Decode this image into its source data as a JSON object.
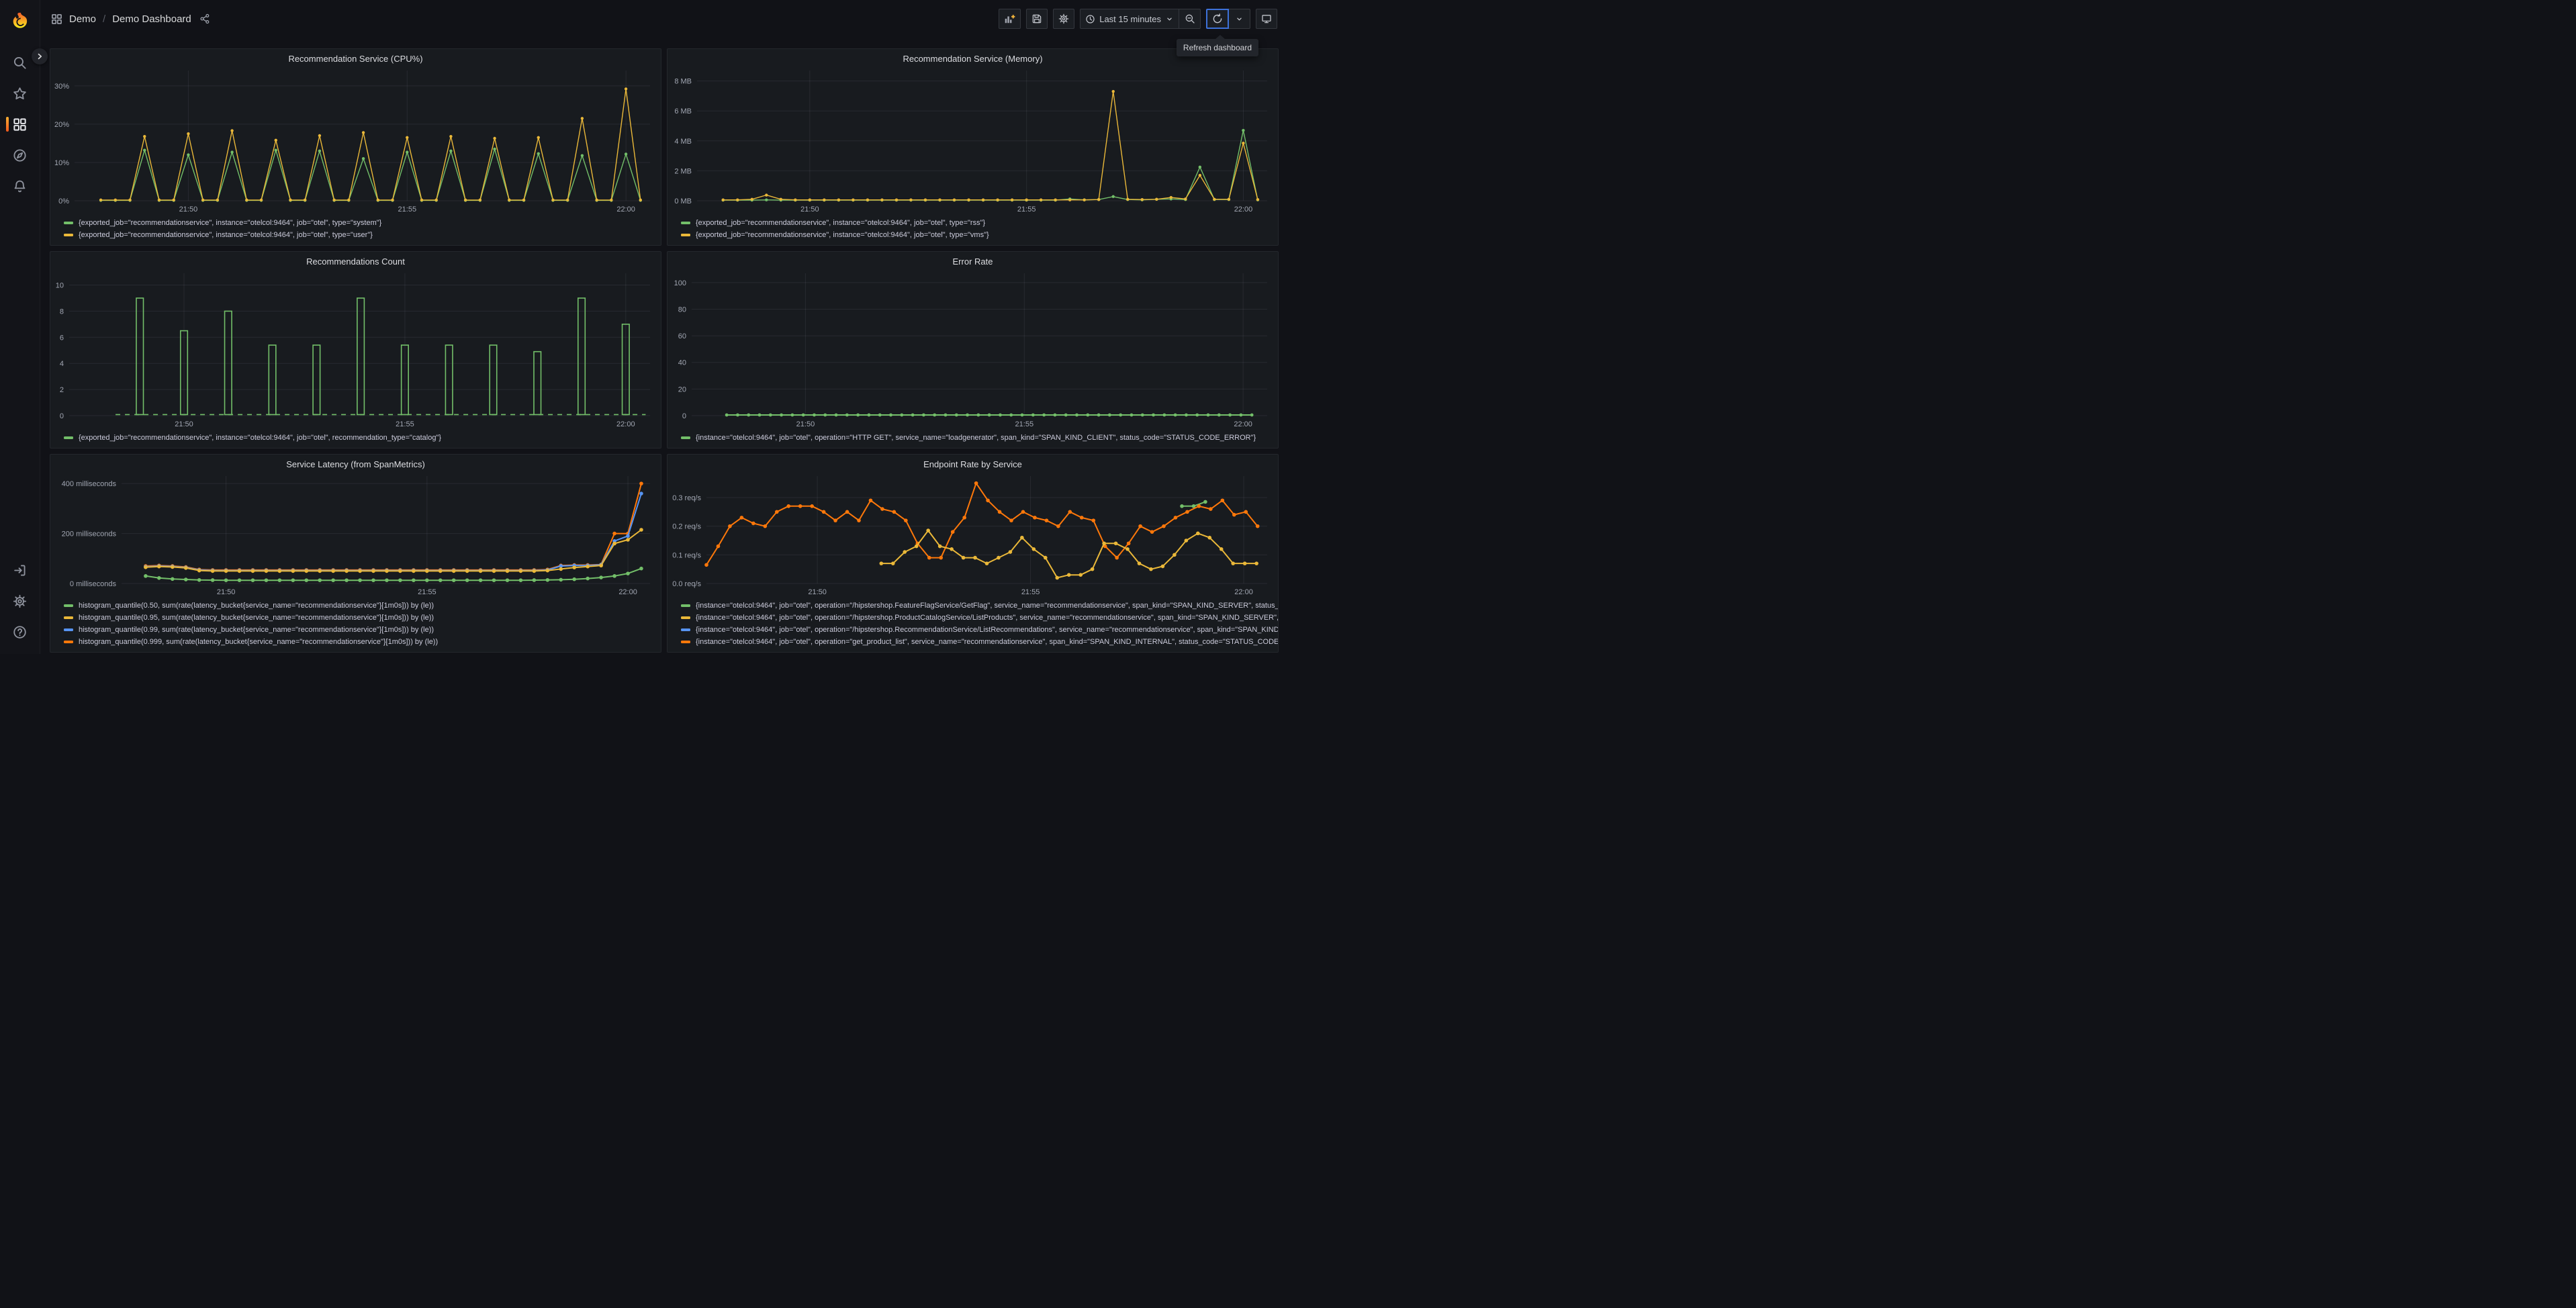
{
  "app": {
    "accent_orange": "#F46800",
    "focus_blue": "#3D71D9",
    "panel_bg": "#181B1F",
    "canvas_bg": "#111217"
  },
  "header": {
    "breadcrumb": {
      "section": "Demo",
      "separator": "/",
      "page": "Demo Dashboard"
    },
    "toolbar": {
      "time_range": "Last 15 minutes",
      "tooltip": "Refresh dashboard"
    }
  },
  "panels": [
    {
      "title": "Recommendation Service (CPU%)",
      "legend": [
        {
          "color": "#73BF69",
          "label": "{exported_job=\"recommendationservice\", instance=\"otelcol:9464\", job=\"otel\", type=\"system\"}"
        },
        {
          "color": "#EAB839",
          "label": "{exported_job=\"recommendationservice\", instance=\"otelcol:9464\", job=\"otel\", type=\"user\"}"
        }
      ],
      "chart_data": {
        "type": "line",
        "ml": 36,
        "xlim": [
          1.4,
          14.55
        ],
        "ylim": [
          0,
          34
        ],
        "xticks": [
          {
            "v": 4,
            "label": "21:50"
          },
          {
            "v": 9,
            "label": "21:55"
          },
          {
            "v": 14,
            "label": "22:00"
          }
        ],
        "yticks": [
          {
            "v": 0,
            "label": "0%"
          },
          {
            "v": 10,
            "label": "10%"
          },
          {
            "v": 20,
            "label": "20%"
          },
          {
            "v": 30,
            "label": "30%"
          }
        ],
        "series": [
          {
            "name": "system",
            "color": "#73BF69",
            "x0": 2.0,
            "dx": 0.3333,
            "lw": 1.4,
            "r": 2.2,
            "y": [
              0.1,
              0.1,
              0.1,
              13.2,
              0.1,
              0.1,
              12,
              0.1,
              0.1,
              12.7,
              0.1,
              0.1,
              13.2,
              0.1,
              0.1,
              13,
              0.1,
              0.1,
              11,
              0.1,
              0.1,
              12.7,
              0.1,
              0.1,
              13,
              0.1,
              0.1,
              13.5,
              0.1,
              0.1,
              12.3,
              0.1,
              0.1,
              11.8,
              0.1,
              0.1,
              12.2,
              0.1
            ]
          },
          {
            "name": "user",
            "color": "#EAB839",
            "x0": 2.0,
            "dx": 0.3333,
            "lw": 1.4,
            "r": 2.2,
            "y": [
              0.2,
              0.2,
              0.2,
              16.8,
              0.2,
              0.2,
              17.5,
              0.2,
              0.2,
              18.3,
              0.2,
              0.2,
              15.8,
              0.2,
              0.2,
              17,
              0.2,
              0.2,
              17.8,
              0.2,
              0.2,
              16.5,
              0.2,
              0.2,
              16.8,
              0.2,
              0.2,
              16.3,
              0.2,
              0.2,
              16.5,
              0.2,
              0.2,
              21.5,
              0.2,
              0.2,
              29.2,
              0.2
            ]
          }
        ]
      }
    },
    {
      "title": "Recommendation Service (Memory)",
      "legend": [
        {
          "color": "#73BF69",
          "label": "{exported_job=\"recommendationservice\", instance=\"otelcol:9464\", job=\"otel\", type=\"rss\"}"
        },
        {
          "color": "#EAB839",
          "label": "{exported_job=\"recommendationservice\", instance=\"otelcol:9464\", job=\"otel\", type=\"vms\"}"
        }
      ],
      "chart_data": {
        "type": "line",
        "ml": 44,
        "xlim": [
          1.4,
          14.55
        ],
        "ylim": [
          0,
          8.7
        ],
        "xticks": [
          {
            "v": 4,
            "label": "21:50"
          },
          {
            "v": 9,
            "label": "21:55"
          },
          {
            "v": 14,
            "label": "22:00"
          }
        ],
        "yticks": [
          {
            "v": 0,
            "label": "0 MB"
          },
          {
            "v": 2,
            "label": "2 MB"
          },
          {
            "v": 4,
            "label": "4 MB"
          },
          {
            "v": 6,
            "label": "6 MB"
          },
          {
            "v": 8,
            "label": "8 MB"
          }
        ],
        "series": [
          {
            "name": "rss",
            "color": "#73BF69",
            "x0": 2.0,
            "dx": 0.3333,
            "lw": 1.4,
            "r": 2.2,
            "y": [
              0.04,
              0.04,
              0.04,
              0.06,
              0.04,
              0.04,
              0.04,
              0.04,
              0.04,
              0.04,
              0.04,
              0.04,
              0.04,
              0.04,
              0.04,
              0.04,
              0.04,
              0.04,
              0.04,
              0.04,
              0.04,
              0.04,
              0.04,
              0.04,
              0.12,
              0.06,
              0.08,
              0.28,
              0.08,
              0.06,
              0.1,
              0.12,
              0.08,
              2.25,
              0.08,
              0.08,
              4.7,
              0.06
            ]
          },
          {
            "name": "vms",
            "color": "#EAB839",
            "x0": 2.0,
            "dx": 0.3333,
            "lw": 1.4,
            "r": 2.2,
            "y": [
              0.06,
              0.06,
              0.1,
              0.38,
              0.1,
              0.06,
              0.06,
              0.06,
              0.06,
              0.06,
              0.06,
              0.06,
              0.06,
              0.06,
              0.06,
              0.06,
              0.06,
              0.06,
              0.06,
              0.06,
              0.06,
              0.06,
              0.06,
              0.06,
              0.06,
              0.06,
              0.08,
              7.3,
              0.1,
              0.08,
              0.1,
              0.22,
              0.12,
              1.7,
              0.1,
              0.1,
              3.85,
              0.08
            ]
          }
        ]
      }
    },
    {
      "title": "Recommendations Count",
      "legend": [
        {
          "color": "#73BF69",
          "label": "{exported_job=\"recommendationservice\", instance=\"otelcol:9464\", job=\"otel\", recommendation_type=\"catalog\"}"
        }
      ],
      "chart_data": {
        "type": "bar",
        "ml": 28,
        "xlim": [
          1.4,
          14.55
        ],
        "ylim": [
          0,
          10.9
        ],
        "xticks": [
          {
            "v": 4,
            "label": "21:50"
          },
          {
            "v": 9,
            "label": "21:55"
          },
          {
            "v": 14,
            "label": "22:00"
          }
        ],
        "yticks": [
          {
            "v": 0,
            "label": "0"
          },
          {
            "v": 2,
            "label": "2"
          },
          {
            "v": 4,
            "label": "4"
          },
          {
            "v": 6,
            "label": "6"
          },
          {
            "v": 8,
            "label": "8"
          },
          {
            "v": 10,
            "label": "10"
          }
        ],
        "dash": {
          "y": 0.08,
          "from": 2.45,
          "to": 14.45,
          "color": "#73BF69"
        },
        "bars": {
          "color": "#73BF69",
          "width": 0.16,
          "x": [
            3,
            4,
            5,
            6,
            7,
            8,
            9,
            10,
            11,
            12,
            13,
            14
          ],
          "h": [
            9,
            6.5,
            8,
            5.4,
            5.4,
            9,
            5.4,
            5.4,
            5.4,
            4.9,
            9,
            7
          ]
        },
        "series": []
      }
    },
    {
      "title": "Error Rate",
      "legend": [
        {
          "color": "#73BF69",
          "label": "{instance=\"otelcol:9464\", job=\"otel\", operation=\"HTTP GET\", service_name=\"loadgenerator\", span_kind=\"SPAN_KIND_CLIENT\", status_code=\"STATUS_CODE_ERROR\"}"
        }
      ],
      "chart_data": {
        "type": "line",
        "ml": 36,
        "xlim": [
          1.4,
          14.55
        ],
        "ylim": [
          0,
          107
        ],
        "xticks": [
          {
            "v": 4,
            "label": "21:50"
          },
          {
            "v": 9,
            "label": "21:55"
          },
          {
            "v": 14,
            "label": "22:00"
          }
        ],
        "yticks": [
          {
            "v": 0,
            "label": "0"
          },
          {
            "v": 20,
            "label": "20"
          },
          {
            "v": 40,
            "label": "40"
          },
          {
            "v": 60,
            "label": "60"
          },
          {
            "v": 80,
            "label": "80"
          },
          {
            "v": 100,
            "label": "100"
          }
        ],
        "series": [
          {
            "name": "error-rate",
            "color": "#73BF69",
            "x0": 2.2,
            "dx": 0.25,
            "n": 49,
            "const_y": 0.5,
            "lw": 2,
            "r": 2.4
          }
        ]
      }
    },
    {
      "title": "Service Latency (from SpanMetrics)",
      "legend": [
        {
          "color": "#73BF69",
          "label": "histogram_quantile(0.50, sum(rate(latency_bucket{service_name=\"recommendationservice\"}[1m0s])) by (le))"
        },
        {
          "color": "#EAB839",
          "label": "histogram_quantile(0.95, sum(rate(latency_bucket{service_name=\"recommendationservice\"}[1m0s])) by (le))"
        },
        {
          "color": "#5794F2",
          "label": "histogram_quantile(0.99, sum(rate(latency_bucket{service_name=\"recommendationservice\"}[1m0s])) by (le))"
        },
        {
          "color": "#FF780A",
          "label": "histogram_quantile(0.999, sum(rate(latency_bucket{service_name=\"recommendationservice\"}[1m0s])) by (le))"
        }
      ],
      "chart_data": {
        "type": "line",
        "ml": 106,
        "xlim": [
          1.4,
          14.55
        ],
        "ylim": [
          0,
          430
        ],
        "xticks": [
          {
            "v": 4,
            "label": "21:50"
          },
          {
            "v": 9,
            "label": "21:55"
          },
          {
            "v": 14,
            "label": "22:00"
          }
        ],
        "yticks": [
          {
            "v": 0,
            "label": "0 milliseconds"
          },
          {
            "v": 200,
            "label": "200 milliseconds"
          },
          {
            "v": 400,
            "label": "400 milliseconds"
          }
        ],
        "series": [
          {
            "name": "p999",
            "color": "#FF780A",
            "x0": 2.0,
            "dx": 0.3333,
            "lw": 2,
            "r": 2.8,
            "y": [
              70,
              72,
              70,
              66,
              56,
              54,
              54,
              54,
              54,
              54,
              54,
              54,
              54,
              54,
              54,
              54,
              54,
              54,
              54,
              54,
              54,
              54,
              54,
              54,
              54,
              54,
              54,
              54,
              54,
              54,
              56,
              72,
              74,
              74,
              76,
              200,
              200,
              400
            ]
          },
          {
            "name": "p99",
            "color": "#5794F2",
            "x0": 2.0,
            "dx": 0.3333,
            "lw": 2,
            "r": 2.8,
            "y": [
              67,
              70,
              68,
              64,
              54,
              52,
              52,
              52,
              52,
              52,
              52,
              52,
              52,
              52,
              52,
              52,
              52,
              52,
              52,
              52,
              52,
              52,
              52,
              52,
              52,
              52,
              52,
              52,
              52,
              52,
              54,
              70,
              72,
              72,
              75,
              170,
              190,
              360
            ]
          },
          {
            "name": "p95",
            "color": "#EAB839",
            "x0": 2.0,
            "dx": 0.3333,
            "lw": 2,
            "r": 2.8,
            "y": [
              65,
              68,
              66,
              62,
              52,
              50,
              50,
              50,
              50,
              50,
              50,
              50,
              50,
              50,
              50,
              50,
              50,
              50,
              50,
              50,
              50,
              50,
              50,
              50,
              50,
              50,
              50,
              50,
              50,
              50,
              52,
              58,
              64,
              68,
              72,
              160,
              175,
              215
            ]
          },
          {
            "name": "p50",
            "color": "#73BF69",
            "x0": 2.0,
            "dx": 0.3333,
            "lw": 2,
            "r": 2.8,
            "y": [
              30,
              22,
              18,
              16,
              14,
              13.5,
              13,
              13,
              13,
              13,
              13,
              13,
              13,
              13,
              13,
              13,
              13,
              13,
              13,
              13,
              13,
              13,
              13,
              13,
              13,
              13,
              13,
              13,
              13,
              13.5,
              14,
              15,
              17,
              20,
              24,
              30,
              40,
              60
            ]
          }
        ]
      }
    },
    {
      "title": "Endpoint Rate by Service",
      "legend": [
        {
          "color": "#73BF69",
          "label": "{instance=\"otelcol:9464\", job=\"otel\", operation=\"/hipstershop.FeatureFlagService/GetFlag\", service_name=\"recommendationservice\", span_kind=\"SPAN_KIND_SERVER\", status_code=\"STATUS_CODE_OK\"}"
        },
        {
          "color": "#EAB839",
          "label": "{instance=\"otelcol:9464\", job=\"otel\", operation=\"/hipstershop.ProductCatalogService/ListProducts\", service_name=\"recommendationservice\", span_kind=\"SPAN_KIND_SERVER\", status_code=\"STATUS_CODE_OK\"}"
        },
        {
          "color": "#5794F2",
          "label": "{instance=\"otelcol:9464\", job=\"otel\", operation=\"/hipstershop.RecommendationService/ListRecommendations\", service_name=\"recommendationservice\", span_kind=\"SPAN_KIND_SERVER\", status_code=\"STATUS_CODE_OK\"}"
        },
        {
          "color": "#FF780A",
          "label": "{instance=\"otelcol:9464\", job=\"otel\", operation=\"get_product_list\", service_name=\"recommendationservice\", span_kind=\"SPAN_KIND_INTERNAL\", status_code=\"STATUS_CODE_OK\"}"
        }
      ],
      "chart_data": {
        "type": "line",
        "ml": 58,
        "xlim": [
          1.4,
          14.55
        ],
        "ylim": [
          0,
          0.375
        ],
        "xticks": [
          {
            "v": 4,
            "label": "21:50"
          },
          {
            "v": 9,
            "label": "21:55"
          },
          {
            "v": 14,
            "label": "22:00"
          }
        ],
        "yticks": [
          {
            "v": 0,
            "label": "0.0 req/s"
          },
          {
            "v": 0.1,
            "label": "0.1 req/s"
          },
          {
            "v": 0.2,
            "label": "0.2 req/s"
          },
          {
            "v": 0.3,
            "label": "0.3 req/s"
          }
        ],
        "series": [
          {
            "name": "get-flag",
            "color": "#73BF69",
            "x0": 12.55,
            "dx": 0.275,
            "lw": 2,
            "r": 2.8,
            "y": [
              0.27,
              0.27,
              0.285
            ]
          },
          {
            "name": "get-product-list",
            "color": "#FF780A",
            "x0": 1.4,
            "dx": 0.275,
            "lw": 2,
            "r": 2.8,
            "y": [
              0.065,
              0.13,
              0.2,
              0.23,
              0.21,
              0.2,
              0.25,
              0.27,
              0.27,
              0.27,
              0.25,
              0.22,
              0.25,
              0.22,
              0.29,
              0.26,
              0.25,
              0.22,
              0.14,
              0.09,
              0.09,
              0.18,
              0.23,
              0.35,
              0.29,
              0.25,
              0.22,
              0.25,
              0.23,
              0.22,
              0.2,
              0.25,
              0.23,
              0.22,
              0.13,
              0.09,
              0.14,
              0.2,
              0.18,
              0.2,
              0.23,
              0.25,
              0.27,
              0.26,
              0.29,
              0.24,
              0.25,
              0.2
            ]
          },
          {
            "name": "list-products",
            "color": "#EAB839",
            "x0": 5.5,
            "dx": 0.275,
            "lw": 2,
            "r": 2.8,
            "y": [
              0.07,
              0.07,
              0.11,
              0.13,
              0.185,
              0.13,
              0.12,
              0.09,
              0.09,
              0.07,
              0.09,
              0.11,
              0.16,
              0.12,
              0.09,
              0.02,
              0.03,
              0.03,
              0.05,
              0.14,
              0.14,
              0.12,
              0.07,
              0.05,
              0.06,
              0.1,
              0.15,
              0.175,
              0.16,
              0.12,
              0.07,
              0.07,
              0.07
            ]
          }
        ]
      }
    }
  ]
}
